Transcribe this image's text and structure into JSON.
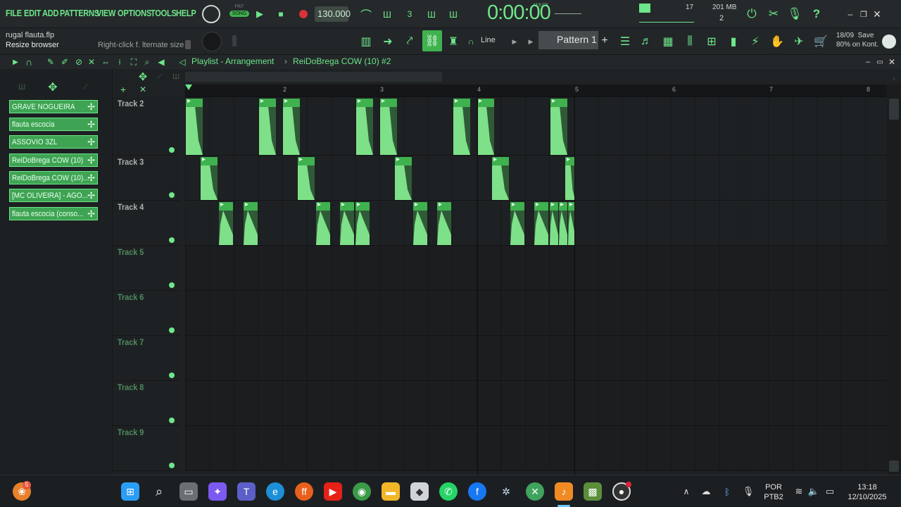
{
  "menu": [
    "FILE",
    "EDIT",
    "ADD",
    "PATTERNS",
    "VIEW",
    "OPTIONS",
    "TOOLS",
    "HELP"
  ],
  "transport": {
    "mode_top": "PAT",
    "mode_bottom": "SONG",
    "tempo": "130.000",
    "time": "0:00:00",
    "time_unit": "M:S:CS"
  },
  "monitor": {
    "cpu": "17",
    "memory": "201 MB",
    "voices": "2"
  },
  "hint": {
    "project": "rugal flauta.flp",
    "action": "Resize browser",
    "right_click": "Right-click f. lternate size"
  },
  "snap": "Line",
  "pattern_selector": "Pattern 1",
  "news": {
    "date": "18/09",
    "label": "Save",
    "text": "80% on Kont."
  },
  "playlist": {
    "title": "Playlist - Arrangement",
    "pattern": "ReiDoBrega COW (10) #2"
  },
  "ruler": [
    "2",
    "3",
    "4",
    "5",
    "6",
    "7",
    "8"
  ],
  "patterns": [
    "GRAVE NOGUEIRA",
    "flauta escocia",
    "ASSOVIO 3ZL",
    "ReiDoBrega COW (10)",
    "ReiDoBrega COW (10)...",
    "[MC OLIVEIRA] - AGO...",
    "flauta escocia (conso..."
  ],
  "tracks": [
    "Track 2",
    "Track 3",
    "Track 4",
    "Track 5",
    "Track 6",
    "Track 7",
    "Track 8",
    "Track 9"
  ],
  "taskbar": {
    "lang_top": "POR",
    "lang_bottom": "PTB2",
    "time": "13:18",
    "date": "12/10/2025",
    "badge": "5"
  },
  "icons": [
    "fl-logo",
    "windows-start",
    "search",
    "task-view",
    "copilot",
    "teams",
    "edge",
    "firefox",
    "youtube",
    "chrome",
    "file-explorer",
    "store",
    "whatsapp",
    "facebook",
    "app",
    "xbox",
    "fl-studio",
    "minecraft",
    "obs"
  ]
}
